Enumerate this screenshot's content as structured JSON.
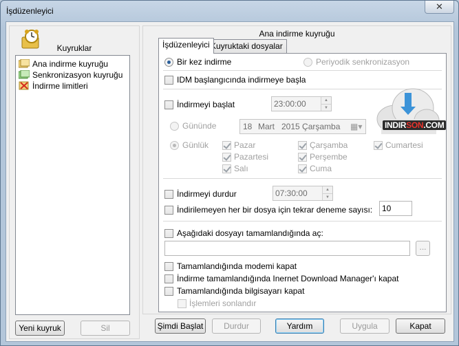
{
  "window": {
    "title": "İşdüzenleyici",
    "close_glyph": "✕"
  },
  "left_panel": {
    "heading": "Kuyruklar",
    "queues": [
      {
        "label": "Ana indirme kuyruğu",
        "icon": "main-queue-icon"
      },
      {
        "label": "Senkronizasyon kuyruğu",
        "icon": "sync-queue-icon"
      },
      {
        "label": "İndirme limitleri",
        "icon": "limits-icon"
      }
    ],
    "new_queue_button": "Yeni kuyruk",
    "delete_button": "Sil"
  },
  "right_panel": {
    "heading": "Ana indirme kuyruğu",
    "tabs": [
      {
        "label": "İşdüzenleyici",
        "active": true
      },
      {
        "label": "Kuyruktaki dosyalar",
        "active": false
      }
    ]
  },
  "scheduler": {
    "once_label": "Bir kez indirme",
    "once_selected": true,
    "periodic_label": "Periyodik senkronizasyon",
    "periodic_selected": false,
    "start_on_idm_label": "IDM başlangıcında indirmeye başla",
    "start_on_idm_checked": false,
    "start_label": "İndirmeyi başlat",
    "start_checked": false,
    "start_time": "23:00:00",
    "on_day_label": "Gününde",
    "date": {
      "day": "18",
      "month": "Mart",
      "year_weekday": "2015 Çarşamba"
    },
    "daily_label": "Günlük",
    "days": [
      {
        "label": "Pazar",
        "checked": true
      },
      {
        "label": "Pazartesi",
        "checked": true
      },
      {
        "label": "Salı",
        "checked": true
      },
      {
        "label": "Çarşamba",
        "checked": true
      },
      {
        "label": "Perşembe",
        "checked": true
      },
      {
        "label": "Cuma",
        "checked": true
      },
      {
        "label": "Cumartesi",
        "checked": true
      }
    ],
    "stop_label": "İndirmeyi durdur",
    "stop_checked": false,
    "stop_time": "07:30:00",
    "retry_label": "İndirilemeyen her bir dosya için tekrar deneme sayısı:",
    "retry_checked": false,
    "retry_count": "10",
    "open_file_label": "Aşağıdaki dosyayı tamamlandığında  aç:",
    "open_file_checked": false,
    "open_file_path": "",
    "browse_button": "...",
    "hangup_label": "Tamamlandığında modemi kapat",
    "exit_idm_label": "İndirme tamamlandığında Inernet Download Manager'ı kapat",
    "shutdown_label": "Tamamlandığında bilgisayarı kapat",
    "kill_processes_label": "İşlemleri sonlandır"
  },
  "logo": {
    "text_a": "INDIR",
    "text_b": "SON",
    "text_c": ".COM"
  },
  "footer": {
    "start_now": "Şimdi Başlat",
    "stop": "Durdur",
    "help": "Yardım",
    "apply": "Uygula",
    "close": "Kapat"
  },
  "colors": {
    "accent": "#2a5f9a",
    "logo_red": "#e8332c"
  }
}
